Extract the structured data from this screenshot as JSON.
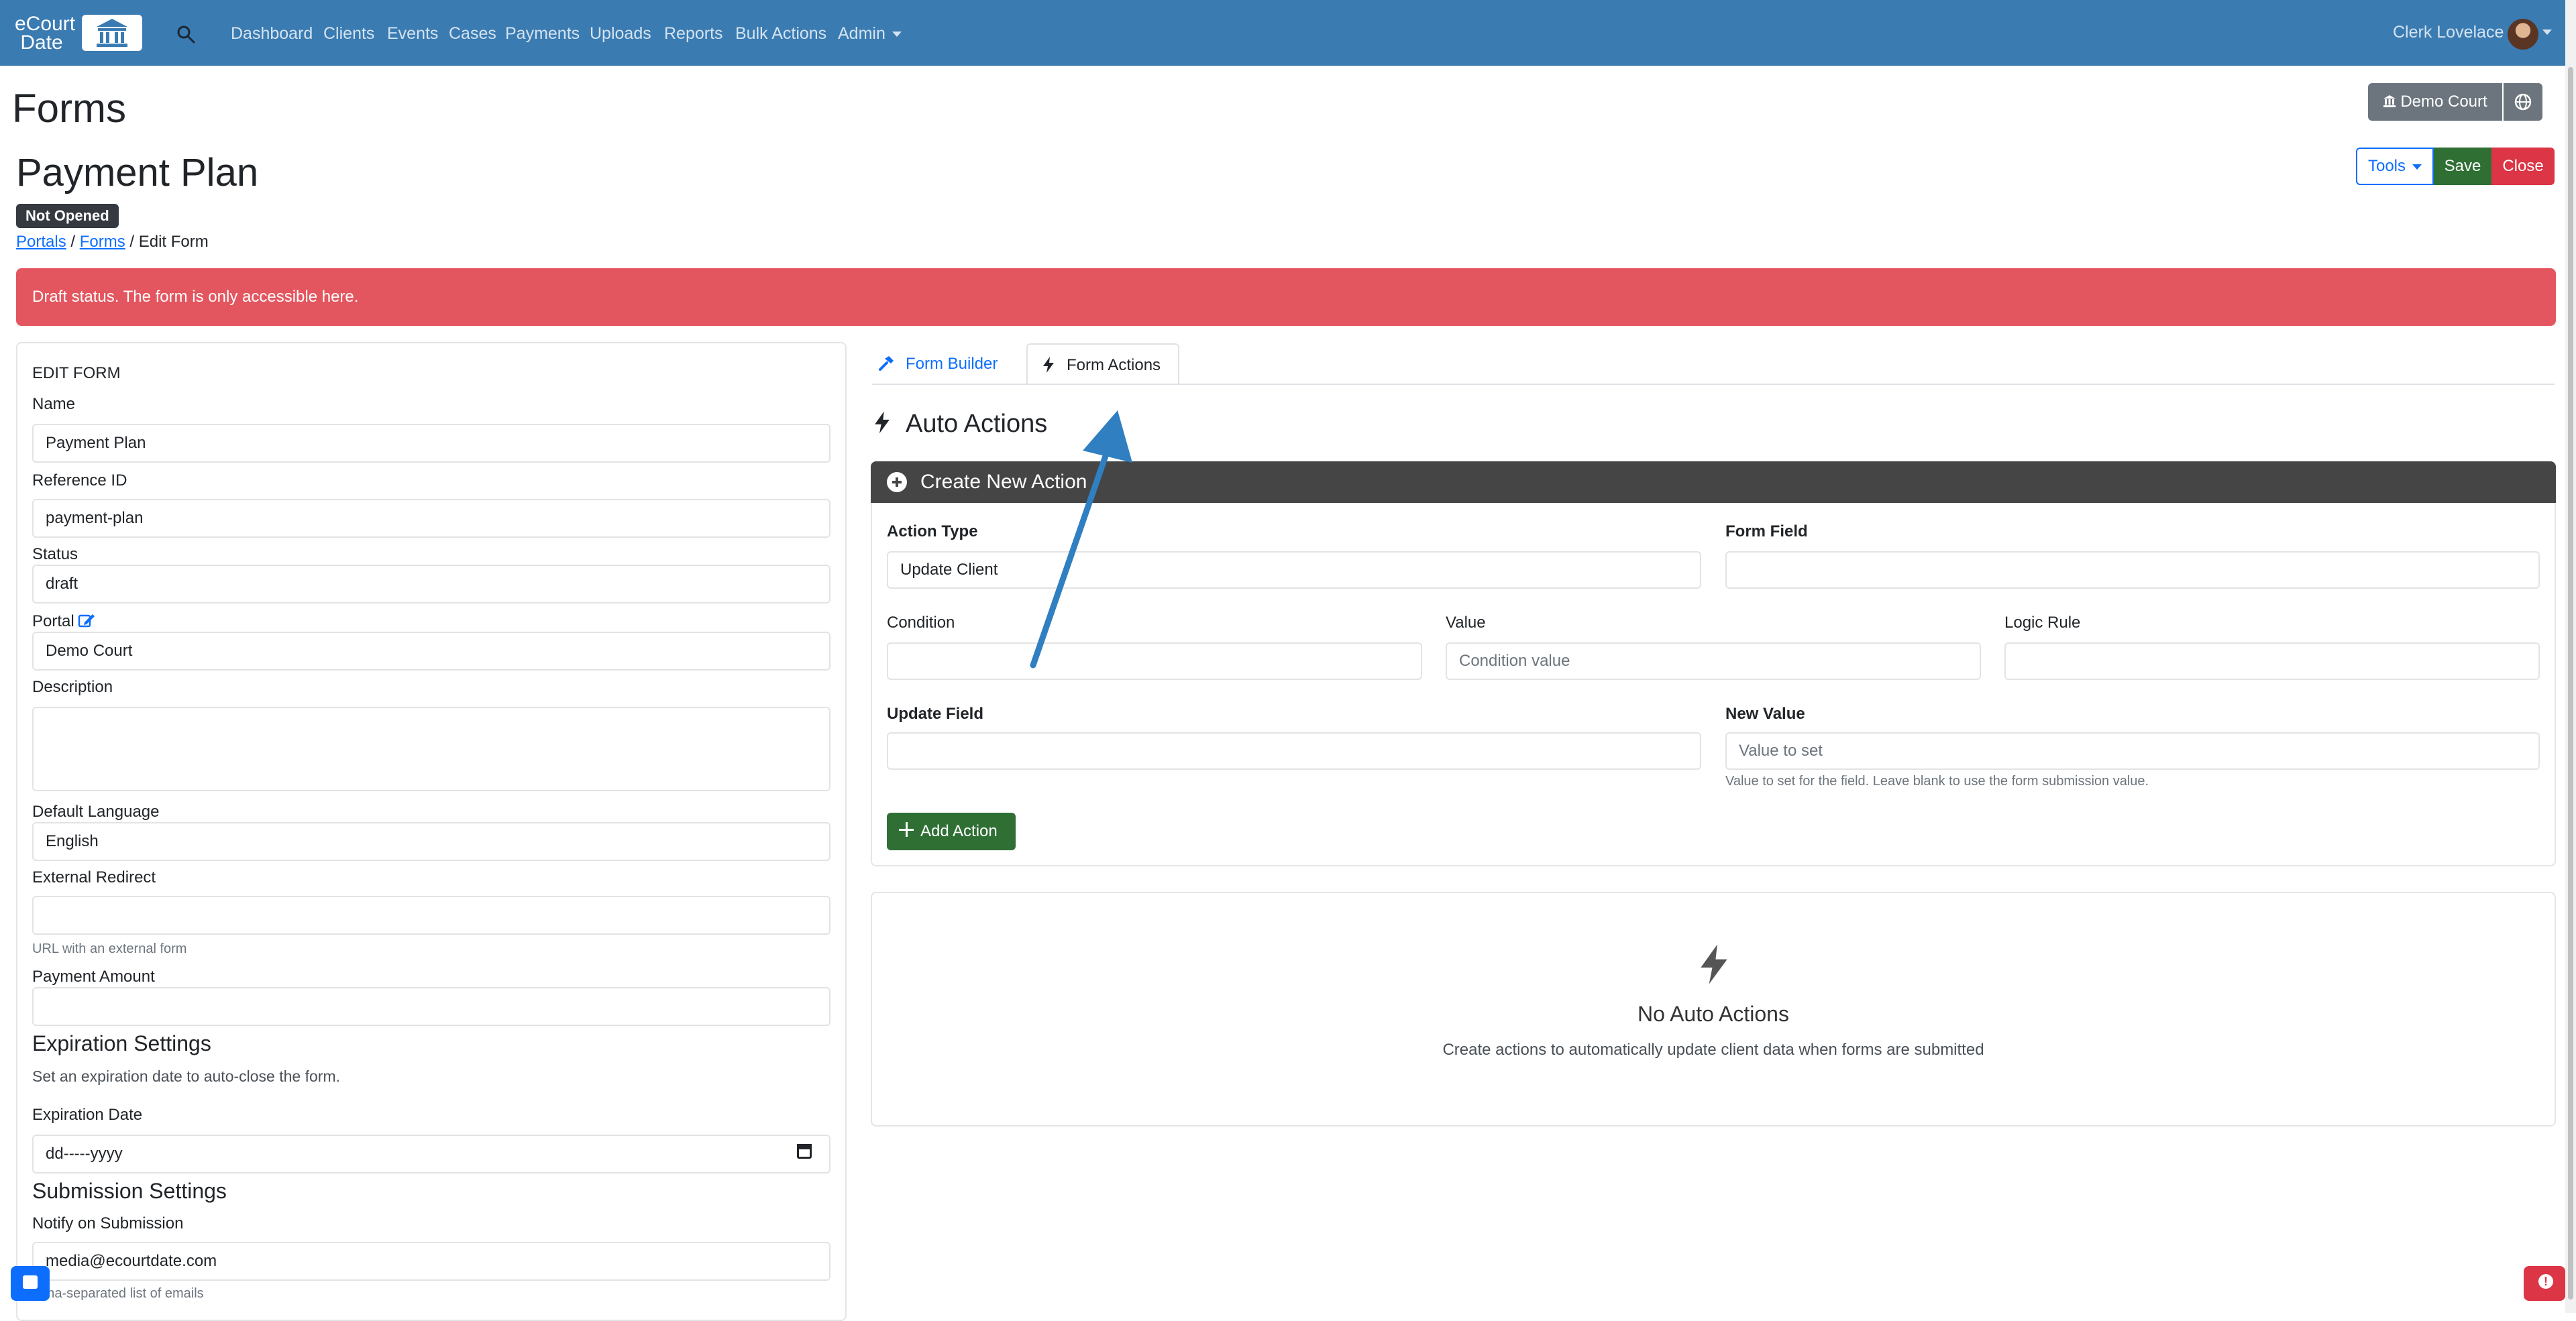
{
  "brand": {
    "name": "eCourt Date"
  },
  "nav": {
    "items": [
      "Dashboard",
      "Clients",
      "Events",
      "Cases",
      "Payments",
      "Uploads",
      "Reports",
      "Bulk Actions",
      "Admin"
    ],
    "user": "Clerk Lovelace"
  },
  "page": {
    "title": "Forms",
    "court_button": "Demo Court"
  },
  "form_header": {
    "title": "Payment Plan",
    "status_badge": "Not Opened",
    "breadcrumb": {
      "portals": "Portals",
      "forms": "Forms",
      "current": "Edit Form"
    },
    "buttons": {
      "tools": "Tools",
      "save": "Save",
      "close": "Close"
    }
  },
  "alert": "Draft status. The form is only accessible here.",
  "edit_form": {
    "heading": "EDIT FORM",
    "name_label": "Name",
    "name_value": "Payment Plan",
    "ref_label": "Reference ID",
    "ref_value": "payment-plan",
    "status_label": "Status",
    "status_value": "draft",
    "portal_label": "Portal",
    "portal_value": "Demo Court",
    "description_label": "Description",
    "language_label": "Default Language",
    "language_value": "English",
    "redirect_label": "External Redirect",
    "redirect_help": "URL with an external form",
    "payment_label": "Payment Amount",
    "expiration_heading": "Expiration Settings",
    "expiration_sub": "Set an expiration date to auto-close the form.",
    "expiration_label": "Expiration Date",
    "expiration_placeholder": "dd-----yyyy",
    "submission_heading": "Submission Settings",
    "notify_label": "Notify on Submission",
    "notify_value": "media@ecourtdate.com",
    "notify_help": "mma-separated list of emails"
  },
  "tabs": {
    "builder": "Form Builder",
    "actions": "Form Actions"
  },
  "auto_actions": {
    "title": "Auto Actions",
    "create_header": "Create New Action",
    "action_type_label": "Action Type",
    "action_type_value": "Update Client",
    "form_field_label": "Form Field",
    "condition_label": "Condition",
    "value_label": "Value",
    "value_placeholder": "Condition value",
    "logic_label": "Logic Rule",
    "update_field_label": "Update Field",
    "new_value_label": "New Value",
    "new_value_placeholder": "Value to set",
    "new_value_help": "Value to set for the field. Leave blank to use the form submission value.",
    "add_button": "Add Action",
    "empty_title": "No Auto Actions",
    "empty_sub": "Create actions to automatically update client data when forms are submitted"
  },
  "colors": {
    "navbar": "#3a7bb2",
    "success": "#2f6f34",
    "danger": "#dc3545",
    "alert": "#e4565f",
    "annotation": "#2f7fc1"
  }
}
